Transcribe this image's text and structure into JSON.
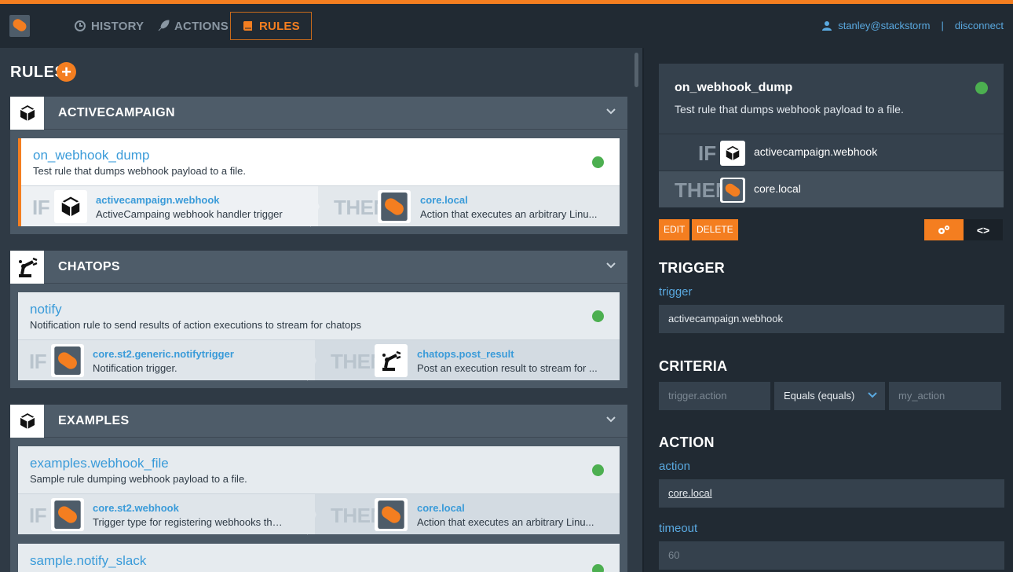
{
  "nav": {
    "history": "HISTORY",
    "actions": "ACTIONS",
    "rules": "RULES",
    "user": "stanley@stackstorm",
    "separator": "|",
    "disconnect": "disconnect"
  },
  "left": {
    "title": "RULES",
    "add_symbol": "+",
    "groups": [
      {
        "name": "ACTIVECAMPAIGN",
        "icon": "cube-icon",
        "rules": [
          {
            "name": "on_webhook_dump",
            "desc": "Test rule that dumps webhook payload to a file.",
            "if_kw": "IF",
            "then_kw": "THEN",
            "trigger": "activecampaign.webhook",
            "trigger_desc": "ActiveCampaing webhook handler trigger",
            "action": "core.local",
            "action_desc": "Action that executes an arbitrary Linu..."
          }
        ]
      },
      {
        "name": "CHATOPS",
        "icon": "robot-arm-icon",
        "rules": [
          {
            "name": "notify",
            "desc": "Notification rule to send results of action executions to stream for chatops",
            "if_kw": "IF",
            "then_kw": "THEN",
            "trigger": "core.st2.generic.notifytrigger",
            "trigger_desc": "Notification trigger.",
            "action": "chatops.post_result",
            "action_desc": "Post an execution result to stream for ..."
          }
        ]
      },
      {
        "name": "EXAMPLES",
        "icon": "cube-icon",
        "rules": [
          {
            "name": "examples.webhook_file",
            "desc": "Sample rule dumping webhook payload to a file.",
            "if_kw": "IF",
            "then_kw": "THEN",
            "trigger": "core.st2.webhook",
            "trigger_desc": "Trigger type for registering webhooks that ...",
            "action": "core.local",
            "action_desc": "Action that executes an arbitrary Linu..."
          },
          {
            "name": "sample.notify_slack"
          }
        ]
      }
    ]
  },
  "detail": {
    "name": "on_webhook_dump",
    "desc": "Test rule that dumps webhook payload to a file.",
    "if_kw": "IF",
    "then_kw": "THEN",
    "trigger": "activecampaign.webhook",
    "action": "core.local",
    "edit": "EDIT",
    "delete": "DELETE",
    "toggle_code": "<>",
    "trigger_section": "TRIGGER",
    "trigger_label": "trigger",
    "trigger_value": "activecampaign.webhook",
    "criteria_section": "CRITERIA",
    "criteria_key_placeholder": "trigger.action",
    "criteria_op": "Equals (equals)",
    "criteria_value_placeholder": "my_action",
    "action_section": "ACTION",
    "action_label": "action",
    "action_value": "core.local",
    "timeout_label": "timeout",
    "timeout_placeholder": "60"
  },
  "colors": {
    "accent": "#f47e20",
    "link": "#3a9bd9",
    "enabled": "#4caf50"
  }
}
